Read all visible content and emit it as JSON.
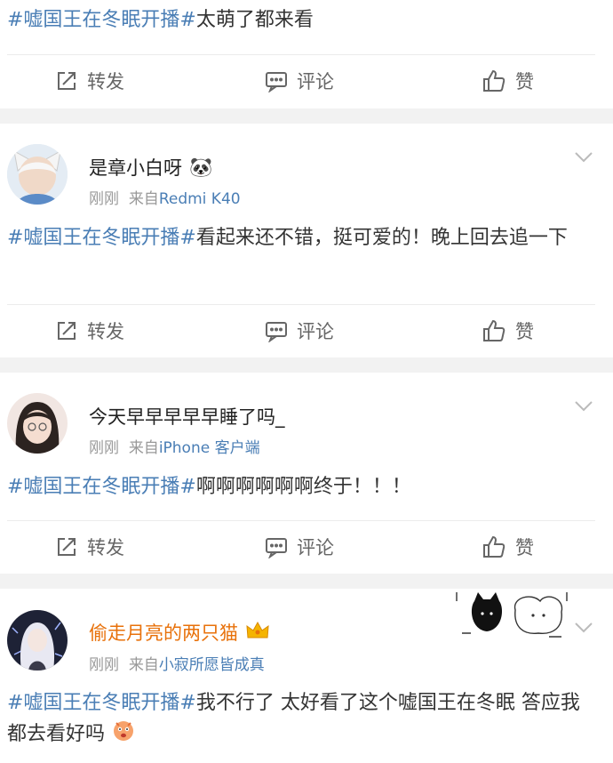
{
  "colors": {
    "topic": "#4a7eb5",
    "gold_name": "#e8710a",
    "meta": "#999999"
  },
  "actions": {
    "repost": "转发",
    "comment": "评论",
    "like": "赞"
  },
  "meta_prefix": "来自",
  "posts": [
    {
      "topic": "#嘘国王在冬眠开播#",
      "text": "太萌了都来看"
    },
    {
      "username": "是章小白呀",
      "badge_icon": "panda-emoji",
      "badge": "🐼",
      "time": "刚刚",
      "source": "Redmi K40",
      "topic": "#嘘国王在冬眠开播#",
      "text": "看起来还不错，挺可爱的！晚上回去追一下"
    },
    {
      "username": "今天早早早早早睡了吗_",
      "time": "刚刚",
      "source": "iPhone 客户端",
      "topic": "#嘘国王在冬眠开播#",
      "text": "啊啊啊啊啊啊终于！！！"
    },
    {
      "username": "偷走月亮的两只猫",
      "badge_icon": "crown-icon",
      "time": "刚刚",
      "source": "小寂所愿皆成真",
      "topic": "#嘘国王在冬眠开播#",
      "text": "我不行了 太好看了这个嘘国王在冬眠 答应我都去看好吗"
    }
  ]
}
